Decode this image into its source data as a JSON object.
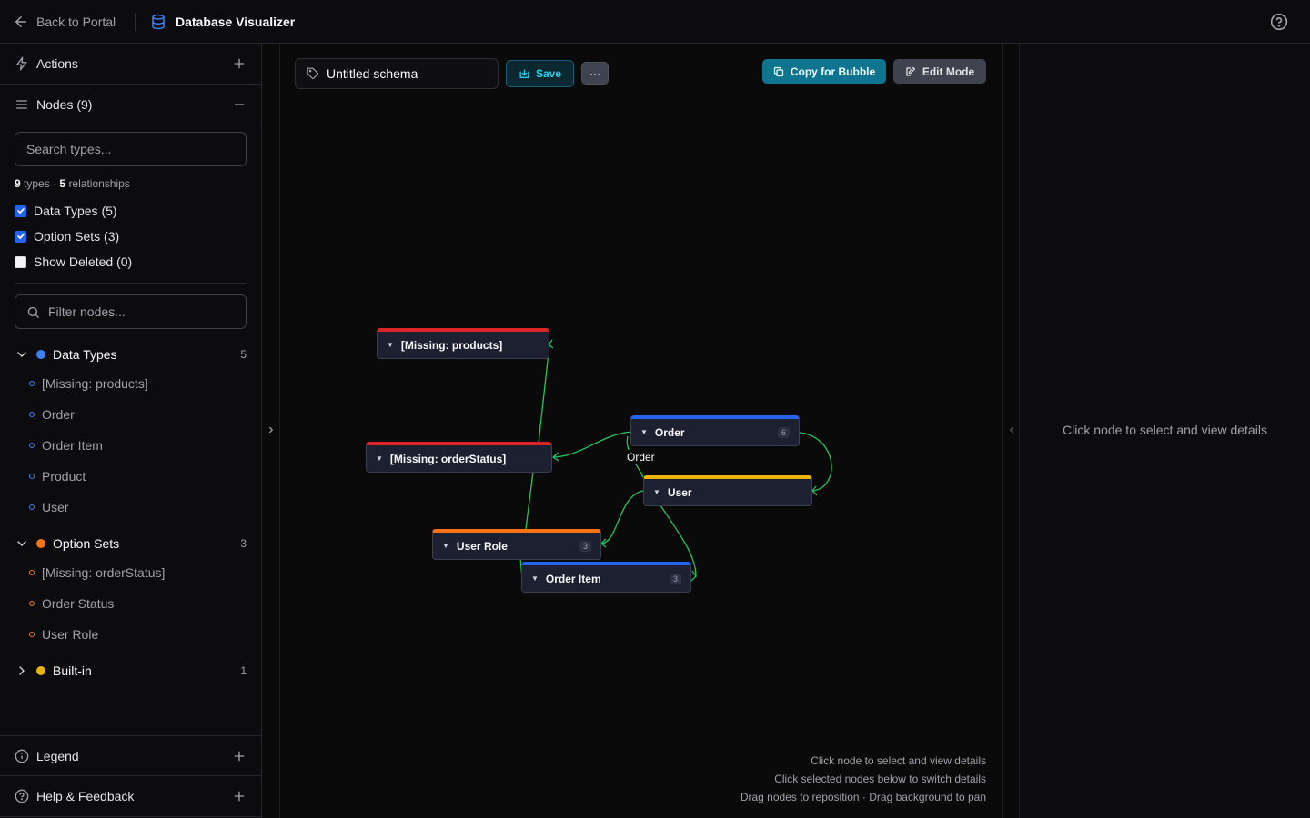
{
  "topbar": {
    "back_label": "Back to Portal",
    "title": "Database Visualizer"
  },
  "sidebar": {
    "actions_label": "Actions",
    "nodes_label": "Nodes (9)",
    "search_placeholder": "Search types...",
    "counts": {
      "types_num": "9",
      "types_label": "types",
      "sep": "·",
      "rel_num": "5",
      "rel_label": "relationships"
    },
    "checkboxes": [
      {
        "label": "Data Types (5)",
        "checked": true
      },
      {
        "label": "Option Sets (3)",
        "checked": true
      },
      {
        "label": "Show Deleted (0)",
        "checked": false
      }
    ],
    "filter_placeholder": "Filter nodes...",
    "groups": [
      {
        "name": "Data Types",
        "count": "5",
        "color": "#3b82f6",
        "expanded": true,
        "items": [
          "[Missing: products]",
          "Order",
          "Order Item",
          "Product",
          "User"
        ]
      },
      {
        "name": "Option Sets",
        "count": "3",
        "color": "#f97316",
        "expanded": true,
        "items": [
          "[Missing: orderStatus]",
          "Order Status",
          "User Role"
        ]
      },
      {
        "name": "Built-in",
        "count": "1",
        "color": "#eab308",
        "expanded": false,
        "items": []
      }
    ],
    "legend_label": "Legend",
    "help_label": "Help & Feedback"
  },
  "toolbar": {
    "schema_name": "Untitled schema",
    "save_label": "Save",
    "more_label": "···",
    "copy_label": "Copy for Bubble",
    "edit_label": "Edit Mode"
  },
  "graph": {
    "nodes": [
      {
        "name": "[Missing: products]",
        "count": "",
        "color": "#dc2626"
      },
      {
        "name": "[Missing: orderStatus]",
        "count": "",
        "color": "#dc2626"
      },
      {
        "name": "Order",
        "count": "6",
        "color": "#2563eb"
      },
      {
        "name": "User",
        "count": "",
        "color": "#eab308"
      },
      {
        "name": "User Role",
        "count": "3",
        "color": "#f97316"
      },
      {
        "name": "Order Item",
        "count": "3",
        "color": "#2563eb"
      }
    ],
    "edge_label": "Order",
    "edge_color": "#22c55e"
  },
  "hints": [
    "Click node to select and view details",
    "Click selected nodes below to switch details",
    "Drag nodes to reposition · Drag background to pan"
  ],
  "detail_panel": {
    "message": "Click node to select and view details"
  }
}
